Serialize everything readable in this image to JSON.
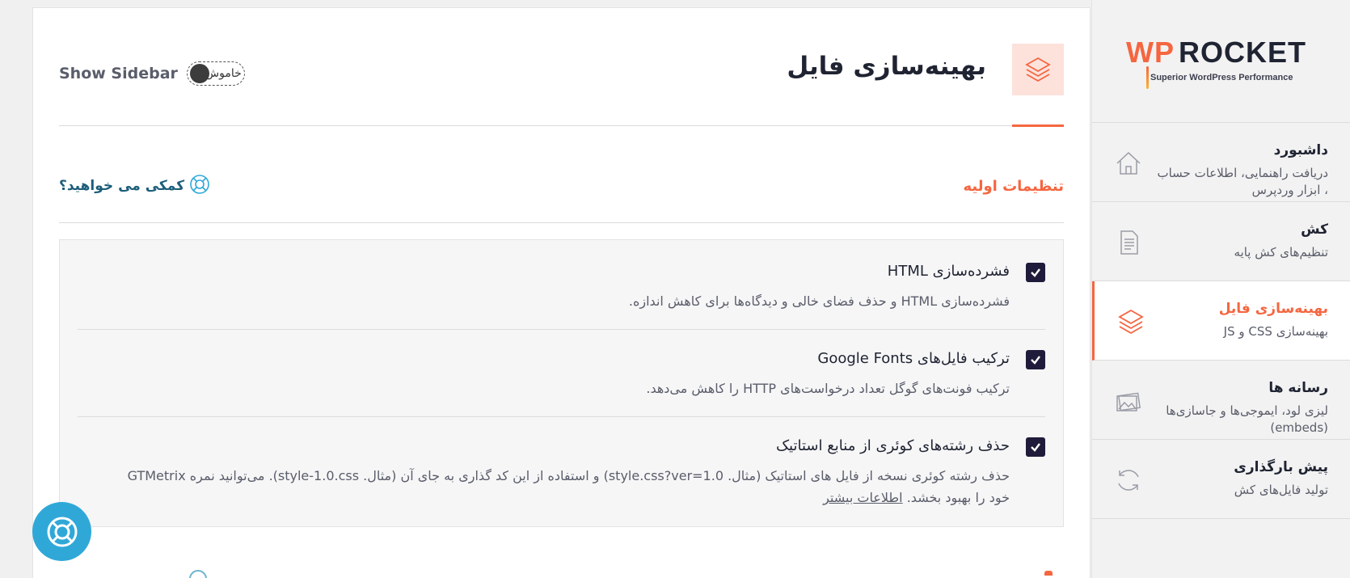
{
  "app": {
    "logo_wp": "WP",
    "logo_rocket": "ROCKET",
    "logo_tagline": "Superior WordPress Performance"
  },
  "sidebar": {
    "items": [
      {
        "title": "داشبورد",
        "desc": "دریافت راهنمایی، اطلاعات حساب ، ابزار وردپرس",
        "icon": "home-icon",
        "active": false
      },
      {
        "title": "کش",
        "desc": "تنظیم‌های کش پایه",
        "icon": "document-icon",
        "active": false
      },
      {
        "title": "بهینه‌سازی فایل",
        "desc": "بهینه‌سازی CSS و JS",
        "icon": "layers-icon",
        "active": true
      },
      {
        "title": "رسانه ها",
        "desc": "لیزی لود، ایموجی‌ها و جاسازی‌ها (embeds)",
        "icon": "images-icon",
        "active": false
      },
      {
        "title": "پیش بارگذاری",
        "desc": "تولید فایل‌های کش",
        "icon": "refresh-icon",
        "active": false
      }
    ]
  },
  "header": {
    "title": "بهینه‌سازی فایل",
    "show_sidebar_label": "Show Sidebar",
    "toggle_label": "خاموش"
  },
  "section": {
    "title": "تنظیمات اولیه",
    "help_label": "کمکی می خواهید؟"
  },
  "options": [
    {
      "title": "فشرده‌سازی HTML",
      "desc": "فشرده‌سازی HTML و حذف فضای خالی و دیدگاه‌ها برای کاهش اندازه.",
      "checked": true
    },
    {
      "title": "ترکیب فایل‌های Google Fonts",
      "desc": "ترکیب فونت‌های گوگل تعداد درخواست‌های HTTP را کاهش می‌دهد.",
      "checked": true
    },
    {
      "title": "حذف رشته‌های کوئری از منابع استاتیک",
      "desc": "حذف رشته کوئری نسخه از فایل های استاتیک (مثال. style.css?ver=1.0) و استفاده از این کد گذاری به جای آن (مثال. style-1.0.css). می‌توانید نمره GTMetrix خود را بهبود بخشد.",
      "link": "اطلاعات بیشتر",
      "checked": true
    }
  ],
  "colors": {
    "accent": "#f56640",
    "help_blue": "#2fa8d8",
    "checkbox": "#1f1b3a"
  }
}
